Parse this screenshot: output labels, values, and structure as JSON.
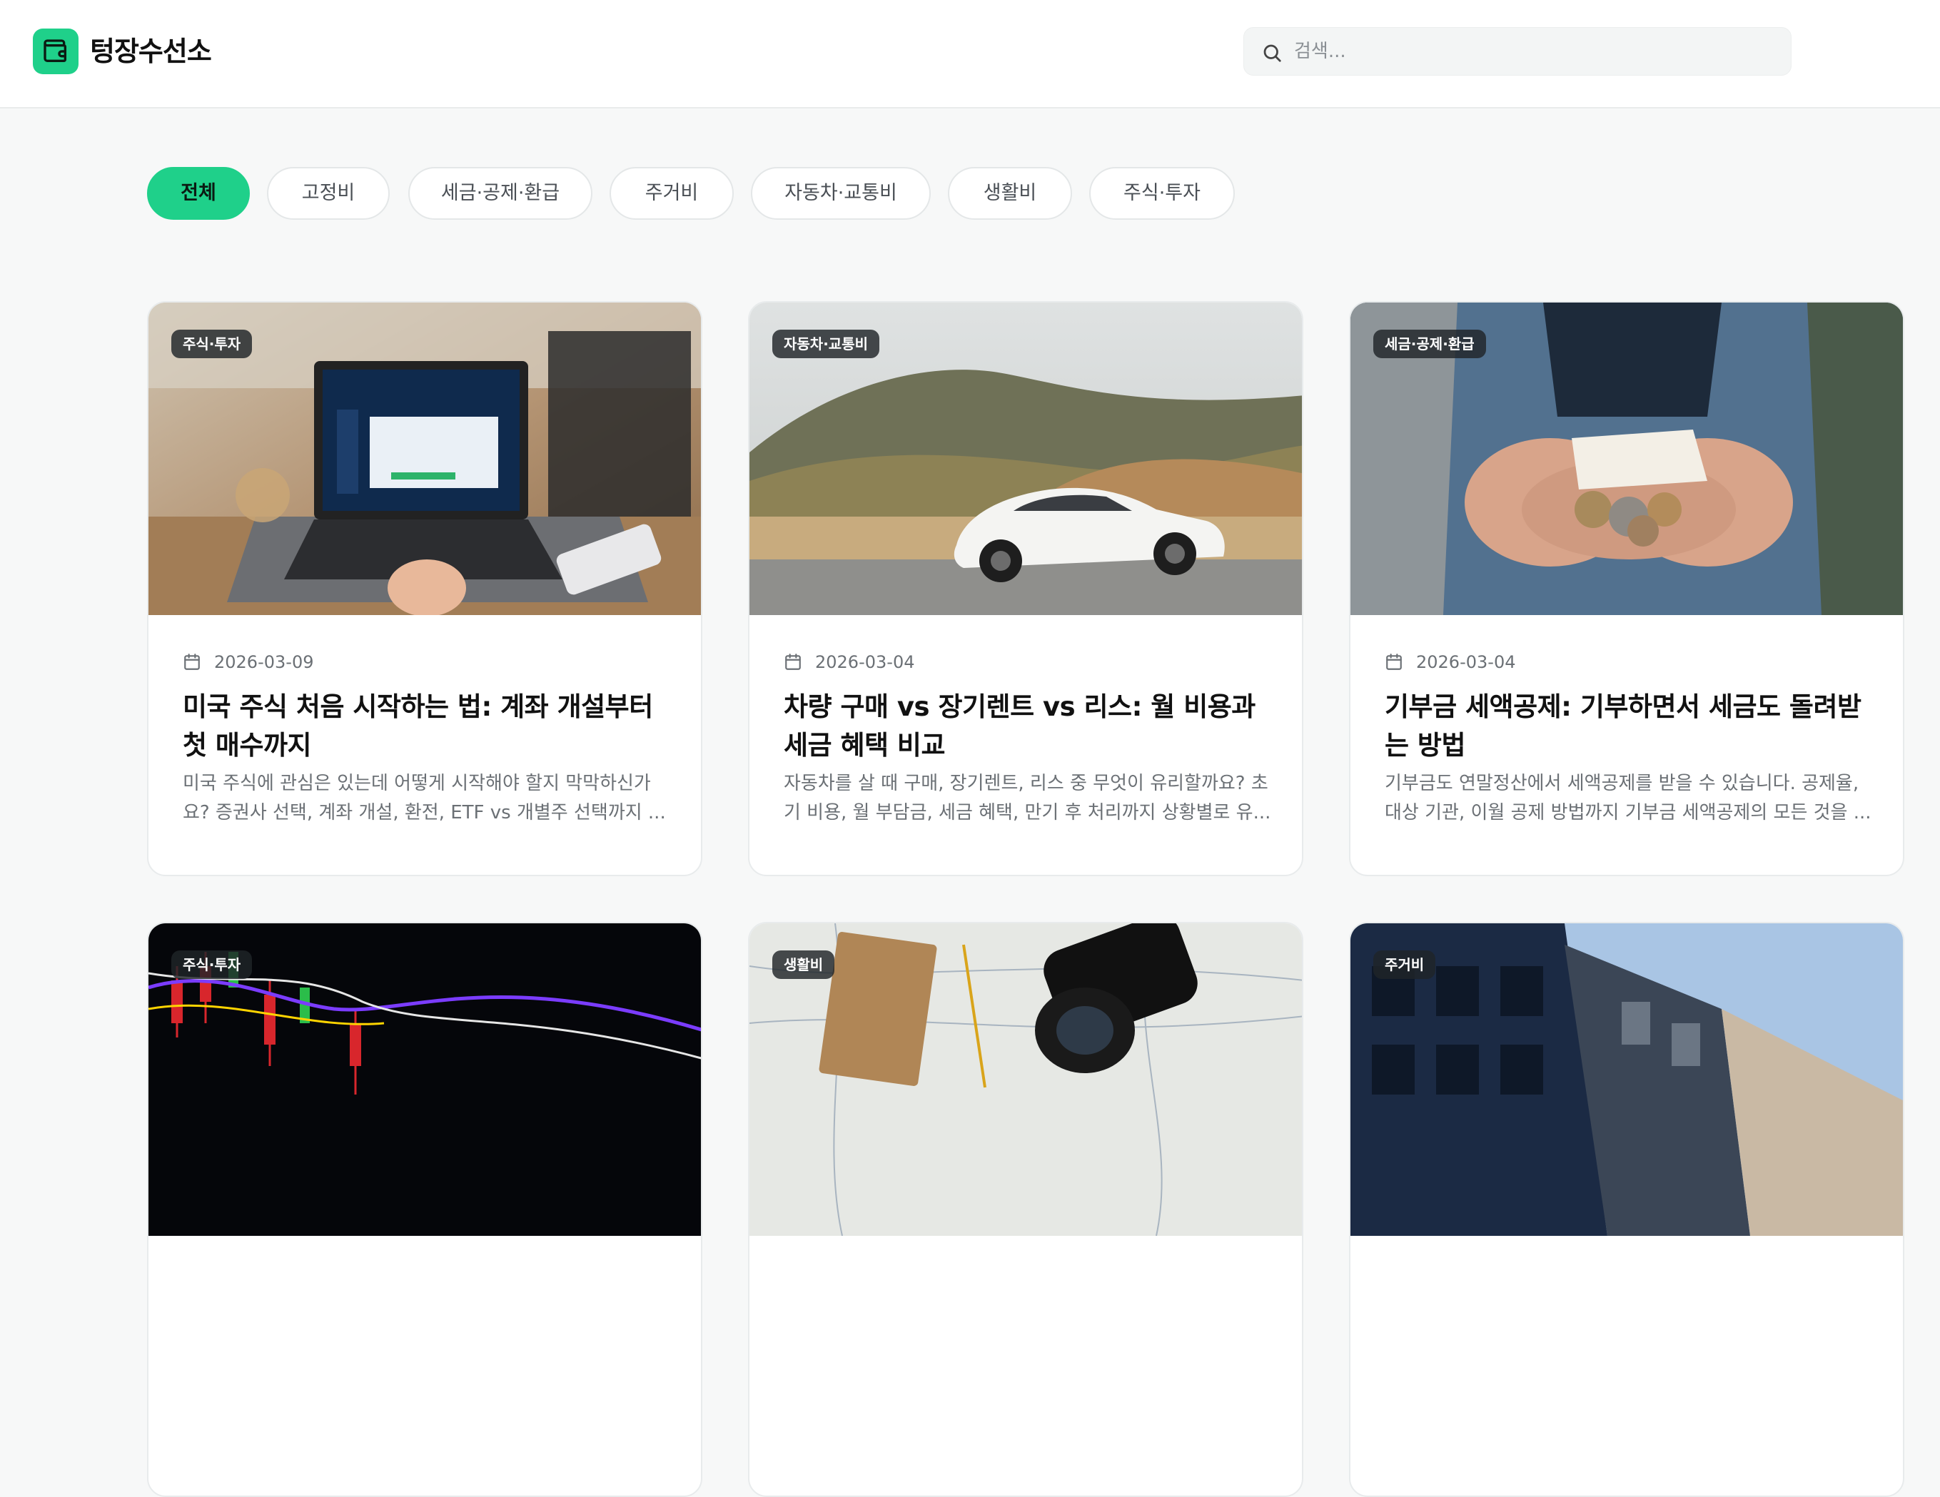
{
  "header": {
    "brand": "텅장수선소",
    "search_placeholder": "검색..."
  },
  "categories": [
    "전체",
    "고정비",
    "세금·공제·환급",
    "주거비",
    "자동차·교통비",
    "생활비",
    "주식·투자"
  ],
  "posts": [
    {
      "category": "주식·투자",
      "date": "2026-03-09",
      "title": "미국 주식 처음 시작하는 법: 계좌 개설부터 첫 매수까지",
      "excerpt": "미국 주식에 관심은 있는데 어떻게 시작해야 할지 막막하신가요? 증권사 선택, 계좌 개설, 환전, ETF vs 개별주 선택까지 ..."
    },
    {
      "category": "자동차·교통비",
      "date": "2026-03-04",
      "title": "차량 구매 vs 장기렌트 vs 리스: 월 비용과 세금 혜택 비교",
      "excerpt": "자동차를 살 때 구매, 장기렌트, 리스 중 무엇이 유리할까요? 초기 비용, 월 부담금, 세금 혜택, 만기 후 처리까지 상황별로 유..."
    },
    {
      "category": "세금·공제·환급",
      "date": "2026-03-04",
      "title": "기부금 세액공제: 기부하면서 세금도 돌려받는 방법",
      "excerpt": "기부금도 연말정산에서 세액공제를 받을 수 있습니다. 공제율, 대상 기관, 이월 공제 방법까지 기부금 세액공제의 모든 것을 ..."
    },
    {
      "category": "주식·투자"
    },
    {
      "category": "생활비"
    },
    {
      "category": "주거비"
    }
  ],
  "colors": {
    "accent": "#1fd08a",
    "text": "#111111",
    "muted": "#6b7075"
  }
}
